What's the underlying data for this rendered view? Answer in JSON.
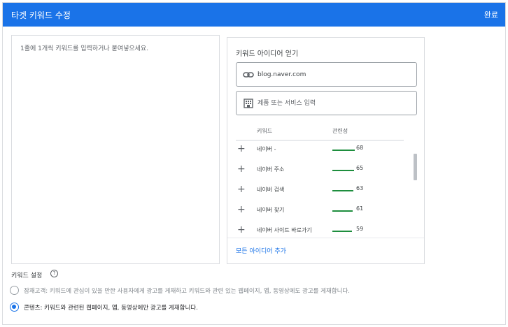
{
  "dialog": {
    "title": "타겟 키워드 수정",
    "done_label": "완료"
  },
  "keyword_input": {
    "placeholder": "1줄에 1개씩 키워드를 입력하거나 붙여넣으세요."
  },
  "ideas": {
    "title": "키워드 아이디어 얻기",
    "url_value": "blog.naver.com",
    "product_placeholder": "제품 또는 서비스 입력",
    "col_keyword": "키워드",
    "col_relevance": "관련성",
    "rows": [
      {
        "keyword": "네이버 -",
        "score": "68",
        "relevance": 0.68
      },
      {
        "keyword": "네이버 주소",
        "score": "65",
        "relevance": 0.65
      },
      {
        "keyword": "네이버 검색",
        "score": "63",
        "relevance": 0.63
      },
      {
        "keyword": "네이버 찾기",
        "score": "61",
        "relevance": 0.61
      },
      {
        "keyword": "네이버 사이트 바로가기",
        "score": "59",
        "relevance": 0.59
      }
    ],
    "add_all_label": "모든 아이디어 추가"
  },
  "settings": {
    "label": "키워드 설정",
    "help_glyph": "?",
    "options": [
      {
        "text": "잠재고객: 키워드에 관심이 있을 만한 사용자에게 광고를 게재하고 키워드와 관련 있는 웹페이지, 앱, 동영상에도 광고를 게재합니다.",
        "selected": false
      },
      {
        "text": "콘텐츠: 키워드와 관련된 웹페이지, 앱, 동영상에만 광고를 게재합니다.",
        "selected": true
      }
    ]
  },
  "colors": {
    "accent": "#1a73e8",
    "bar": "#1e8e3e"
  },
  "icons": {
    "url_field": "link-icon",
    "product_field": "store-icon",
    "row_action": "plus-icon"
  }
}
